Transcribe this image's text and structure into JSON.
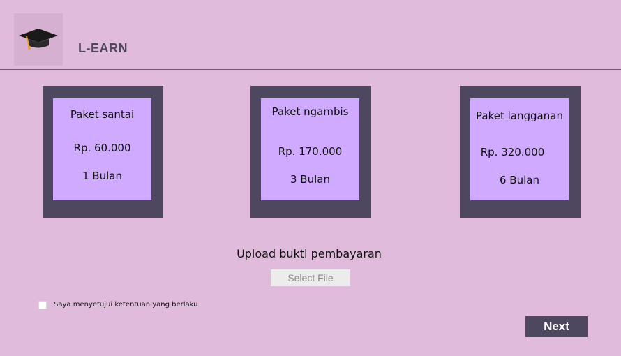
{
  "header": {
    "logo_icon": "graduation-cap-icon",
    "title": "L-EARN"
  },
  "packages": [
    {
      "name": "Paket santai",
      "price": "Rp. 60.000",
      "duration": "1 Bulan"
    },
    {
      "name": "Paket ngambis",
      "price": "Rp. 170.000",
      "duration": "3 Bulan"
    },
    {
      "name": "Paket langganan",
      "price": "Rp. 320.000",
      "duration": "6 Bulan"
    }
  ],
  "upload": {
    "label": "Upload bukti pembayaran",
    "button_label": "Select File"
  },
  "agreement": {
    "label": "Saya menyetujui ketentuan yang berlaku",
    "checked": false
  },
  "next_label": "Next",
  "colors": {
    "background": "#e0bbdb",
    "card_frame": "#4e4760",
    "card_inner": "#cfaaff",
    "button": "#4e4760"
  }
}
